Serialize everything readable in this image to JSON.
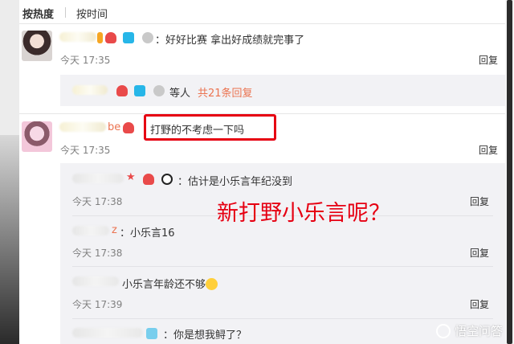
{
  "sort": {
    "hot_label": "按热度",
    "time_label": "按时间"
  },
  "comments": [
    {
      "text": "：好好比赛 拿出好成绩就完事了",
      "time": "今天 17:35",
      "reply": "回复",
      "sub_summary": {
        "suffix": "等人",
        "count_link": "共21条回复"
      }
    },
    {
      "text": "打野的不考虑一下吗",
      "time": "今天 17:35",
      "reply": "回复",
      "name_tail": "be",
      "replies": [
        {
          "text": "：估计是小乐言年纪没到",
          "time": "今天 17:38",
          "reply": "回复"
        },
        {
          "name_tail": "z",
          "text": "：小乐言16",
          "time": "今天 17:38",
          "reply": "回复"
        },
        {
          "text": "小乐言年龄还不够",
          "time": "今天 17:39",
          "reply": "回复"
        },
        {
          "text": "：你是想我鲟了？"
        }
      ]
    }
  ],
  "overlay_text": "新打野小乐言呢？",
  "watermark": "悟空问答",
  "colors": {
    "highlight": "#e60012",
    "link": "#eb7350"
  }
}
